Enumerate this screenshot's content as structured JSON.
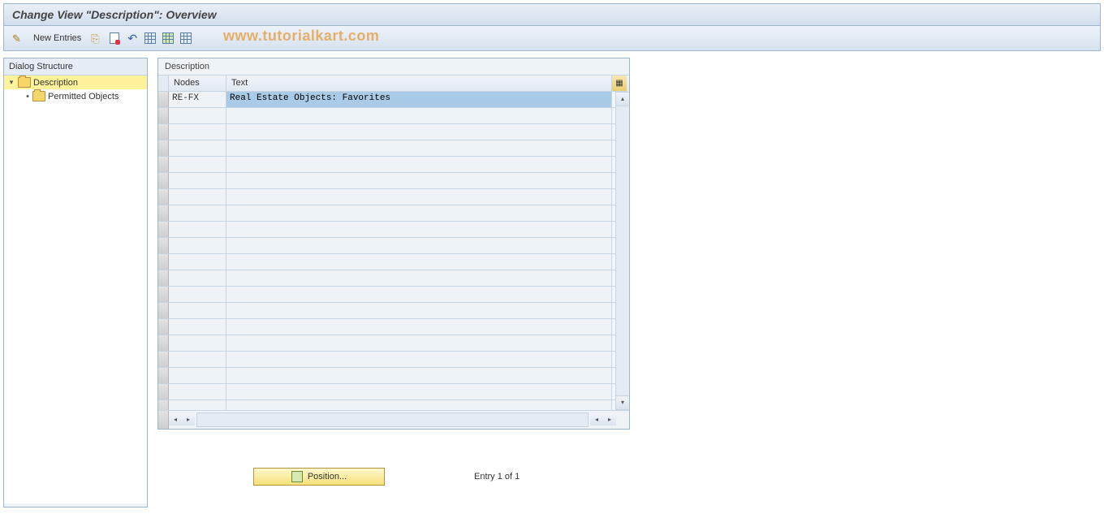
{
  "title": "Change View \"Description\": Overview",
  "toolbar": {
    "new_entries": "New Entries"
  },
  "watermark": "www.tutorialkart.com",
  "tree": {
    "header": "Dialog Structure",
    "items": [
      {
        "label": "Description",
        "selected": true,
        "open": true
      },
      {
        "label": "Permitted Objects",
        "selected": false,
        "open": false
      }
    ]
  },
  "grid": {
    "title": "Description",
    "columns": {
      "nodes": "Nodes",
      "text": "Text"
    },
    "rows": [
      {
        "nodes": "RE-FX",
        "text": "Real Estate Objects: Favorites",
        "text_selected": true
      }
    ],
    "blank_rows": 20
  },
  "footer": {
    "position_label": "Position...",
    "entry_text": "Entry 1 of 1"
  }
}
